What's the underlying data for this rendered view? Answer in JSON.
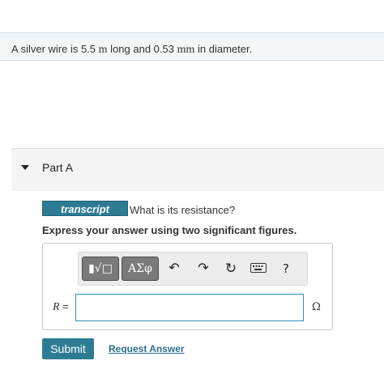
{
  "problem": {
    "text_before": "A silver wire is ",
    "length_value": "5.5",
    "length_unit": "m",
    "text_middle": " long and ",
    "diameter_value": "0.53",
    "diameter_unit": "mm",
    "text_after": " in diameter."
  },
  "part": {
    "label": "Part A"
  },
  "question": {
    "badge": "transcript",
    "text": "What is its resistance?",
    "instructions": "Express your answer using two significant figures."
  },
  "toolbar": {
    "template_label": "▮√□",
    "greek_label": "ΑΣφ",
    "undo_icon": "↶",
    "redo_icon": "↷",
    "reset_icon": "↻",
    "help_label": "?"
  },
  "answer": {
    "variable": "R",
    "equals": " =",
    "value": "",
    "unit": "Ω"
  },
  "actions": {
    "submit_label": "Submit",
    "request_label": "Request Answer"
  },
  "colors": {
    "accent": "#2d7c94",
    "link": "#2b6f8a",
    "input_border": "#2f8fae"
  }
}
